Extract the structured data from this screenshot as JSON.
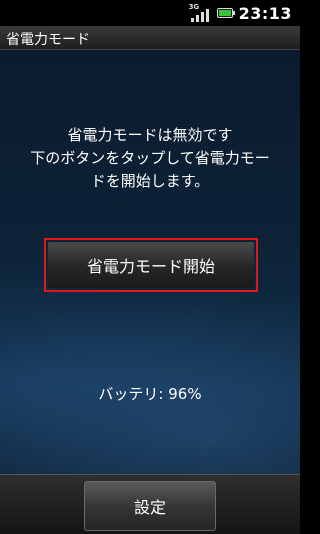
{
  "status_bar": {
    "network_type": "3G",
    "time": "23:13",
    "signal_icon": "signal-bars-icon",
    "battery_icon": "battery-icon",
    "battery_color": "#37c437"
  },
  "title_bar": {
    "title": "省電力モード"
  },
  "message": {
    "lines": [
      "省電力モードは無効です",
      "下のボタンをタップして省電力モー",
      "ドを開始します。"
    ]
  },
  "start_button": {
    "label": "省電力モード開始",
    "highlight_color": "#e01818"
  },
  "battery_status": {
    "text": "バッテリ: 96%"
  },
  "bottom_bar": {
    "settings_label": "設定"
  }
}
